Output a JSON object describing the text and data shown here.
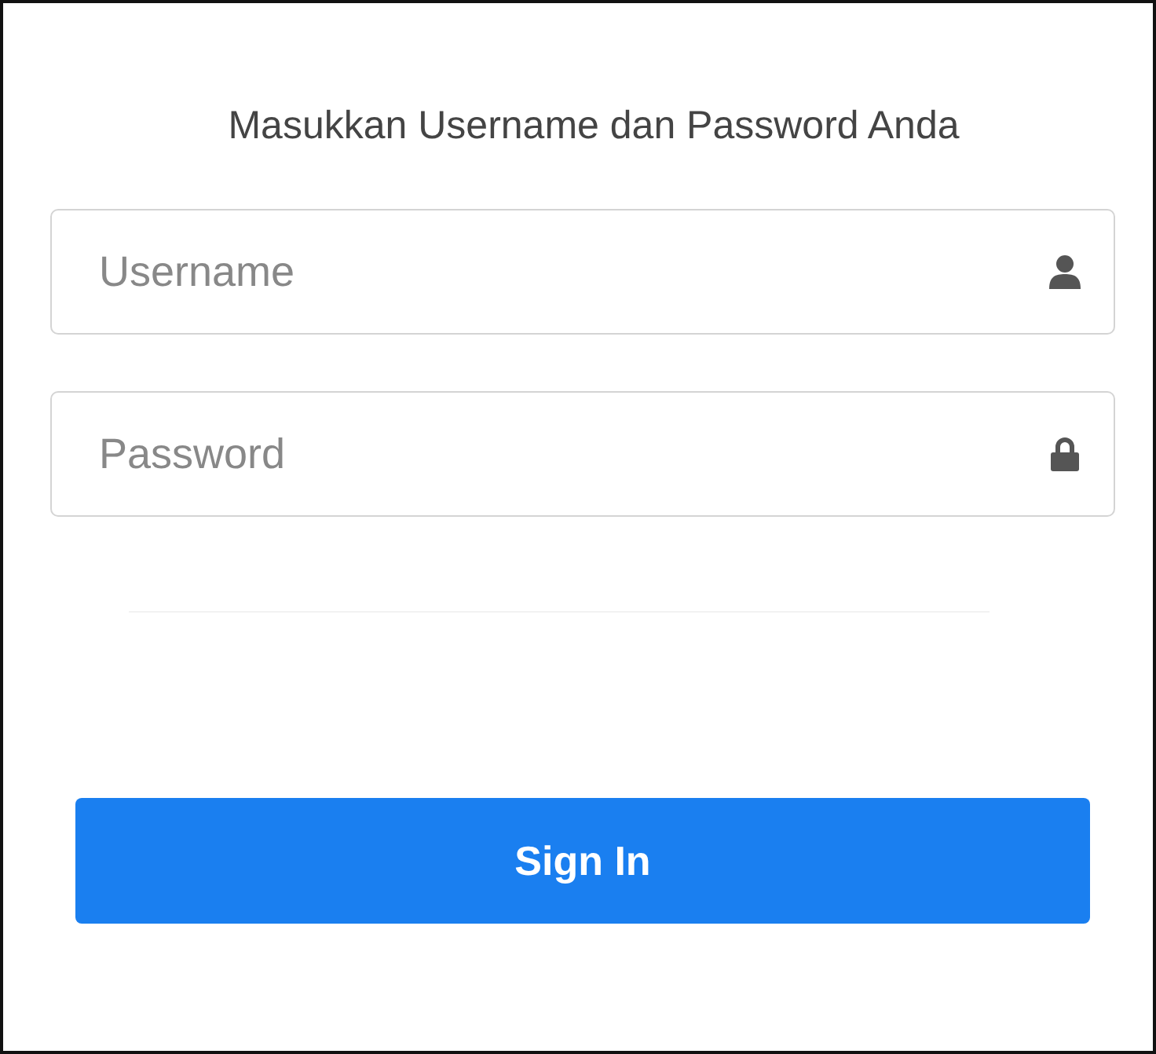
{
  "heading": "Masukkan Username dan Password Anda",
  "fields": [
    {
      "kind": "user",
      "placeholder": "Username"
    },
    {
      "kind": "lock",
      "placeholder": "Password"
    }
  ],
  "button": "Sign In"
}
